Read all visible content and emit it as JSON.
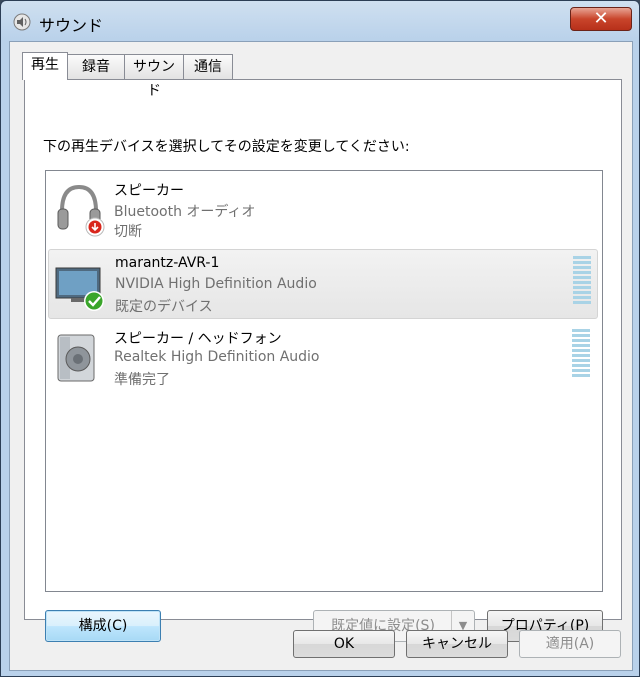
{
  "window": {
    "title": "サウンド",
    "close_label": "✕"
  },
  "tabs": [
    {
      "label": "再生",
      "active": true
    },
    {
      "label": "録音",
      "active": false
    },
    {
      "label": "サウンド",
      "active": false
    },
    {
      "label": "通信",
      "active": false
    }
  ],
  "playback": {
    "instruction": "下の再生デバイスを選択してその設定を変更してください:",
    "devices": [
      {
        "name": "スピーカー",
        "driver": "Bluetooth オーディオ",
        "status": "切断",
        "icon": "headphones-icon",
        "badge": "disconnected-badge-icon"
      },
      {
        "name": "marantz-AVR-1",
        "driver": "NVIDIA High Definition Audio",
        "status": "既定のデバイス",
        "icon": "monitor-icon",
        "badge": "default-check-icon"
      },
      {
        "name": "スピーカー / ヘッドフォン",
        "driver": "Realtek High Definition Audio",
        "status": "準備完了",
        "icon": "speaker-icon",
        "badge": ""
      }
    ],
    "configure_button": "構成(C)",
    "set_default_button": "既定値に設定(S)",
    "properties_button": "プロパティ(P)"
  },
  "footer": {
    "ok": "OK",
    "cancel": "キャンセル",
    "apply": "適用(A)"
  },
  "colors": {
    "accent": "#3c7fb1",
    "check": "#3aa52a",
    "disconnected": "#d9261c",
    "meter": "#a9d3e6"
  }
}
